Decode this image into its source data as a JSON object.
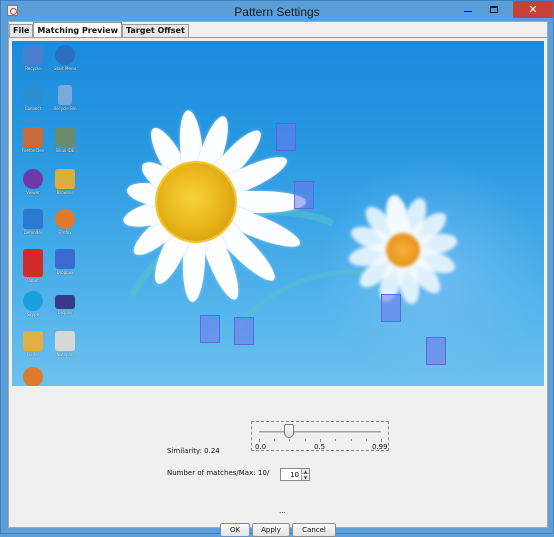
{
  "window": {
    "title": "Pattern Settings",
    "close_glyph": "✕",
    "controls": [
      "minimize",
      "maximize",
      "close"
    ]
  },
  "tabs": [
    {
      "label": "File",
      "active": false
    },
    {
      "label": "Matching Preview",
      "active": true
    },
    {
      "label": "Target Offset",
      "active": false
    }
  ],
  "desktop_icons": [
    {
      "label": "Recycle",
      "icon": "app-icon",
      "color": "#4a7fd0"
    },
    {
      "label": "Start Menu",
      "icon": "lightning-icon",
      "color": "#2a6fc0"
    },
    {
      "label": "Connect",
      "icon": "feather-icon",
      "color": "#2a8fd0"
    },
    {
      "label": "Recycle Bin",
      "icon": "recycle-bin-icon",
      "color": "#7aa8d8"
    },
    {
      "label": "Firefox Dev",
      "icon": "folder-icon",
      "color": "#c86a3a"
    },
    {
      "label": "Sikuli IDE",
      "icon": "monitor-icon",
      "color": "#6a8a6a"
    },
    {
      "label": "Viewer",
      "icon": "media-icon",
      "color": "#6a3aa8"
    },
    {
      "label": "Browser",
      "icon": "mail-icon",
      "color": "#d8b040"
    },
    {
      "label": "Defender",
      "icon": "shield-icon",
      "color": "#2a7ad0"
    },
    {
      "label": "Firefox",
      "icon": "firefox-icon",
      "color": "#e07a2a"
    },
    {
      "label": "Robot",
      "icon": "robot-icon",
      "color": "#d02a2a"
    },
    {
      "label": "Dropbox",
      "icon": "box-icon",
      "color": "#3a6ad0"
    },
    {
      "label": "Skype",
      "icon": "skype-icon",
      "color": "#1aa0e0"
    },
    {
      "label": "Display",
      "icon": "screen-icon",
      "color": "#3a3a8a"
    },
    {
      "label": "Folder",
      "icon": "folder-icon",
      "color": "#e0b040"
    },
    {
      "label": "Notepad",
      "icon": "document-icon",
      "color": "#d8d8d8"
    },
    {
      "label": "Firefox",
      "icon": "firefox-icon",
      "color": "#e07a2a"
    }
  ],
  "matches_count_visible": 7,
  "similarity": {
    "label": "Similarity: 0.24",
    "value": 0.24,
    "min_label": "0.0",
    "mid_label": "0.5",
    "max_label": "0.99"
  },
  "matches": {
    "label": "Number of matches/Max:",
    "count_label": "10/",
    "max_value": "10"
  },
  "status": "...",
  "buttons": {
    "ok": "OK",
    "apply": "Apply",
    "cancel": "Cancel"
  },
  "colors": {
    "title_bar": "#5c9fd8",
    "close_button": "#c7403a",
    "match_overlay": "#6e78eb"
  }
}
